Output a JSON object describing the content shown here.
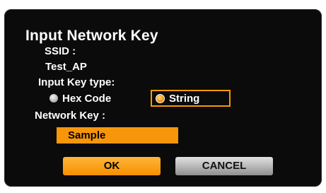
{
  "dialog": {
    "title": "Input Network Key",
    "ssid_label": "SSID :",
    "ssid_value": "Test_AP",
    "key_type_label": "Input Key type:",
    "key_type_options": [
      {
        "label": "Hex Code",
        "selected": false
      },
      {
        "label": "String",
        "selected": true
      }
    ],
    "network_key_label": "Network Key :",
    "network_key_value": "Sample",
    "ok_label": "OK",
    "cancel_label": "CANCEL"
  },
  "colors": {
    "background": "#0b0b0b",
    "accent": "#f7960a",
    "text": "#ffffff",
    "cancel_button": "#bdbdbd"
  },
  "icons": {
    "radio_unselected": "radio-off-icon",
    "radio_selected": "radio-on-icon"
  }
}
